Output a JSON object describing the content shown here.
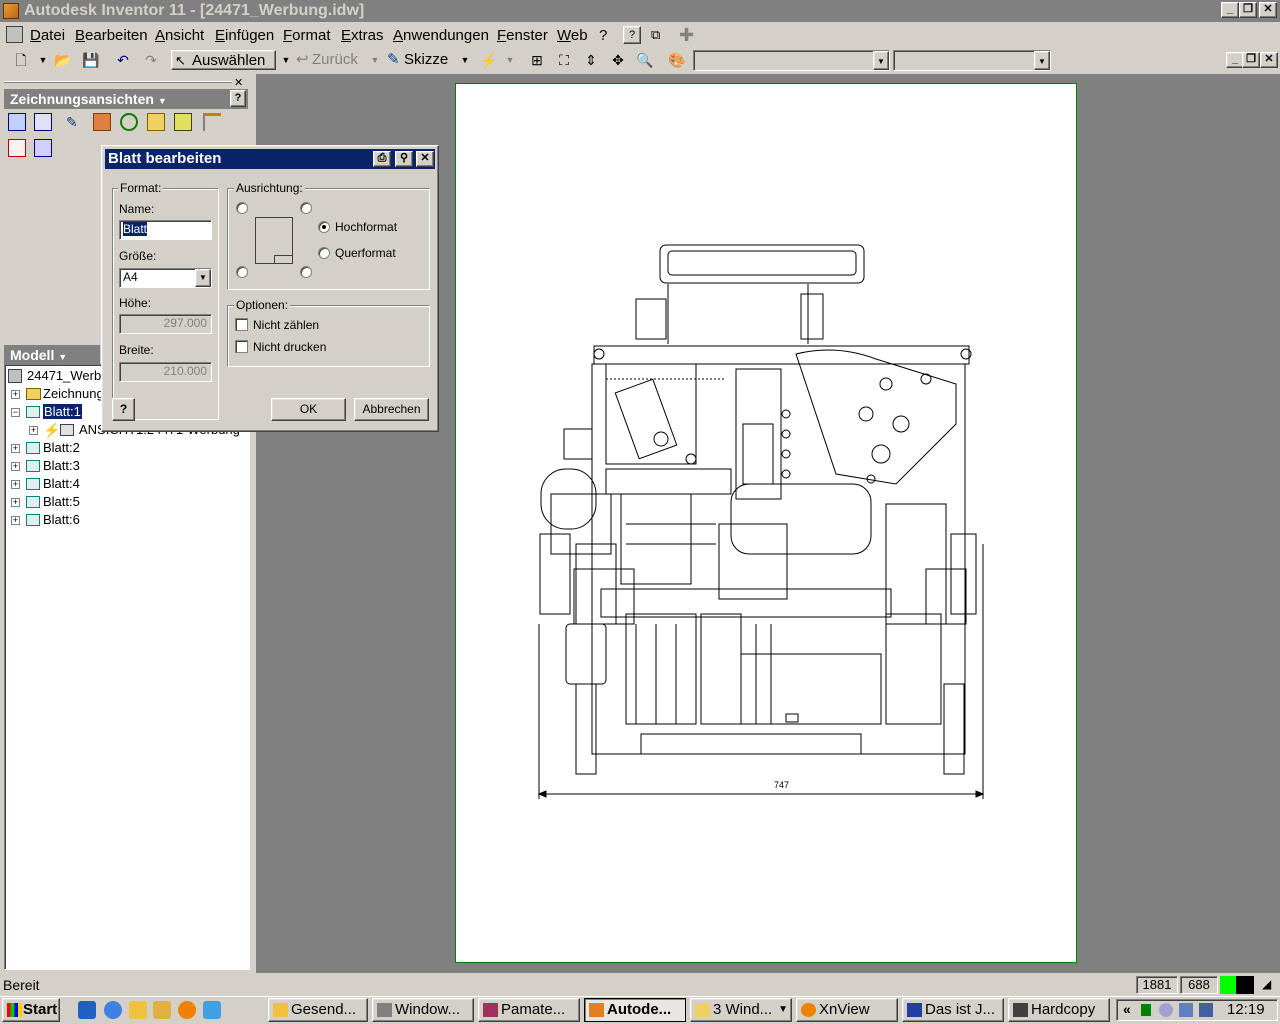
{
  "window": {
    "title": "Autodesk Inventor 11 - [24471_Werbung.idw]"
  },
  "menu": [
    "Datei",
    "Bearbeiten",
    "Ansicht",
    "Einfügen",
    "Format",
    "Extras",
    "Anwendungen",
    "Fenster",
    "Web",
    "?"
  ],
  "toolbar": {
    "select_label": "Auswählen",
    "back_label": "Zurück",
    "sketch_label": "Skizze"
  },
  "panel": {
    "title": "Zeichnungsansichten",
    "model_title": "Modell",
    "tree": [
      {
        "label": "24471_Werbung.idw"
      },
      {
        "label": "Zeichnungsressourcen"
      },
      {
        "label": "Blatt:1"
      },
      {
        "label": "ANSICHT1:24471-Werbung"
      },
      {
        "label": "Blatt:2"
      },
      {
        "label": "Blatt:3"
      },
      {
        "label": "Blatt:4"
      },
      {
        "label": "Blatt:5"
      },
      {
        "label": "Blatt:6"
      }
    ]
  },
  "dialog": {
    "title": "Blatt bearbeiten",
    "format_group": "Format:",
    "name_label": "Name:",
    "name_value": "Blatt",
    "size_label": "Größe:",
    "size_value": "A4",
    "height_label": "Höhe:",
    "height_value": "297.000",
    "width_label": "Breite:",
    "width_value": "210.000",
    "orientation_group": "Ausrichtung:",
    "portrait_label": "Hochformat",
    "landscape_label": "Querformat",
    "options_group": "Optionen:",
    "no_count_label": "Nicht zählen",
    "no_print_label": "Nicht drucken",
    "ok_label": "OK",
    "cancel_label": "Abbrechen"
  },
  "drawing": {
    "dimension_text": "747"
  },
  "status": {
    "text": "Bereit",
    "x": "1881",
    "y": "688"
  },
  "taskbar": {
    "start": "Start",
    "tasks": [
      "Gesend...",
      "Window...",
      "Pamate...",
      "Autode...",
      "3 Wind...",
      "XnView",
      "Das ist J...",
      "Hardcopy"
    ],
    "clock": "12:19"
  }
}
